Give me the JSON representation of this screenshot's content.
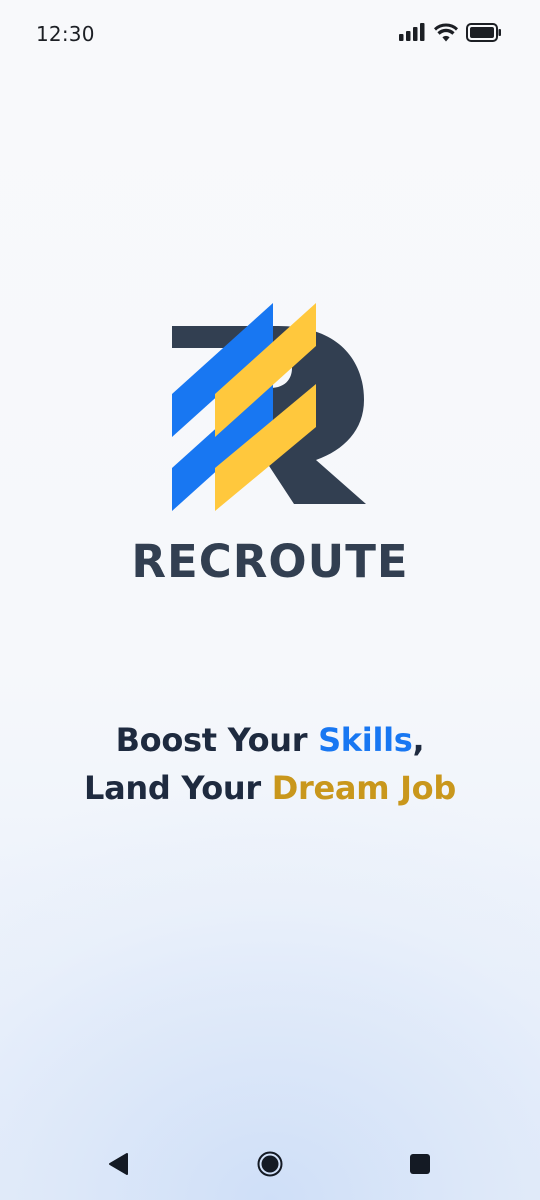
{
  "status_bar": {
    "time": "12:30",
    "icons": [
      "signal-icon",
      "wifi-icon",
      "battery-icon"
    ]
  },
  "brand": {
    "name": "RECROUTE",
    "colors": {
      "dark": "#323f51",
      "blue": "#1877f2",
      "yellow": "#ffc83d"
    }
  },
  "tagline": {
    "line1_prefix": "Boost Your ",
    "line1_highlight": "Skills",
    "line1_suffix": ",",
    "line2_prefix": "Land Your ",
    "line2_highlight": "Dream Job",
    "highlight_colors": {
      "skills": "#1877f2",
      "dream_job": "#c9971c"
    }
  },
  "nav_bar": {
    "buttons": [
      "back-icon",
      "home-icon",
      "recents-icon"
    ]
  }
}
